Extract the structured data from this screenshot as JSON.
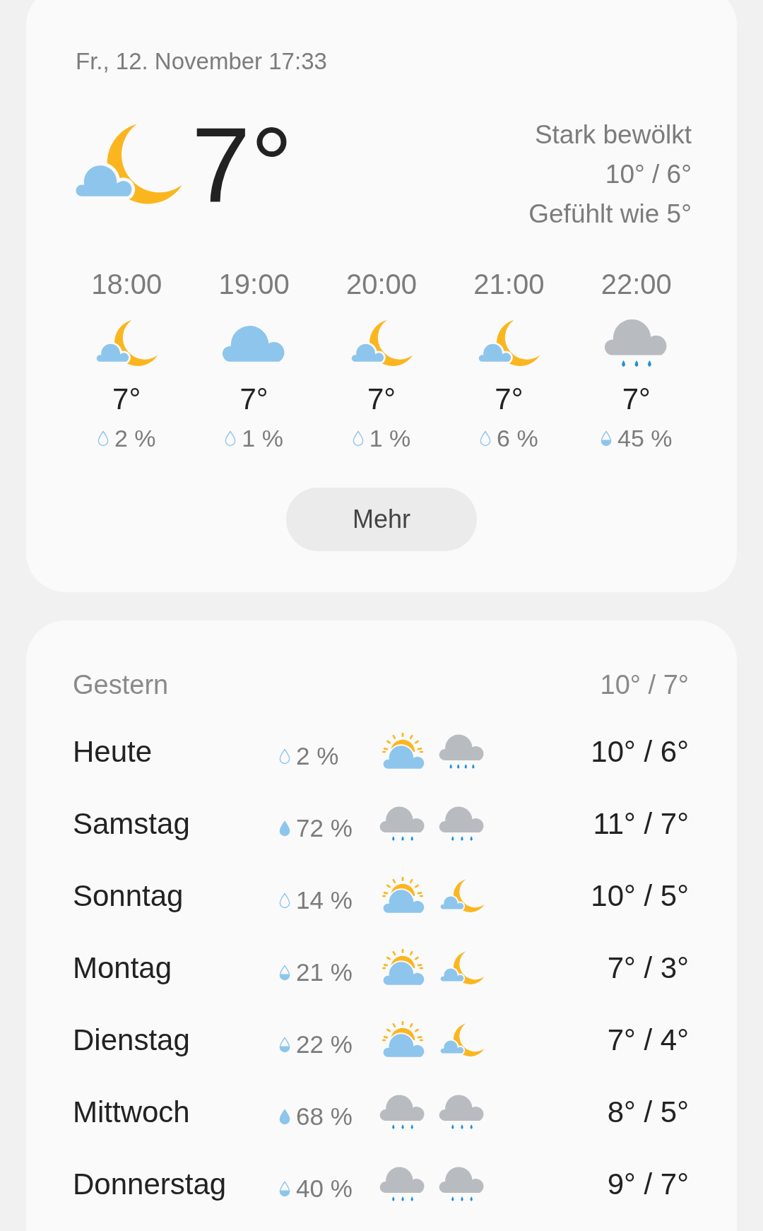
{
  "current": {
    "datetime": "Fr., 12. November 17:33",
    "icon": {
      "kind": "moon-cloud"
    },
    "temperature": "7°",
    "condition": "Stark bewölkt",
    "high_low": "10° / 6°",
    "feels_like": "Gefühlt wie 5°"
  },
  "hourly": [
    {
      "time": "18:00",
      "icon": {
        "kind": "moon-cloud"
      },
      "temperature": "7°",
      "drop": {
        "kind": "empty"
      },
      "precipitation": "2 %"
    },
    {
      "time": "19:00",
      "icon": {
        "kind": "cloud"
      },
      "temperature": "7°",
      "drop": {
        "kind": "empty"
      },
      "precipitation": "1 %"
    },
    {
      "time": "20:00",
      "icon": {
        "kind": "moon-cloud"
      },
      "temperature": "7°",
      "drop": {
        "kind": "empty"
      },
      "precipitation": "1 %"
    },
    {
      "time": "21:00",
      "icon": {
        "kind": "moon-cloud"
      },
      "temperature": "7°",
      "drop": {
        "kind": "empty"
      },
      "precipitation": "6 %"
    },
    {
      "time": "22:00",
      "icon": {
        "kind": "rain"
      },
      "temperature": "7°",
      "drop": {
        "kind": "half"
      },
      "precipitation": "45 %"
    }
  ],
  "more_button": "Mehr",
  "yesterday": {
    "label": "Gestern",
    "high_low": "10° / 7°"
  },
  "daily": [
    {
      "day": "Heute",
      "drop": {
        "kind": "empty"
      },
      "precipitation": "2 %",
      "day_icon": {
        "kind": "sun-cloud"
      },
      "night_icon": {
        "kind": "heavy-rain"
      },
      "high_low": "10° / 6°"
    },
    {
      "day": "Samstag",
      "drop": {
        "kind": "full"
      },
      "precipitation": "72 %",
      "day_icon": {
        "kind": "rain"
      },
      "night_icon": {
        "kind": "rain"
      },
      "high_low": "11° / 7°"
    },
    {
      "day": "Sonntag",
      "drop": {
        "kind": "empty"
      },
      "precipitation": "14 %",
      "day_icon": {
        "kind": "sun-cloud"
      },
      "night_icon": {
        "kind": "moon-cloud"
      },
      "high_low": "10° / 5°"
    },
    {
      "day": "Montag",
      "drop": {
        "kind": "half"
      },
      "precipitation": "21 %",
      "day_icon": {
        "kind": "sun-cloud"
      },
      "night_icon": {
        "kind": "moon-cloud"
      },
      "high_low": "7° / 3°"
    },
    {
      "day": "Dienstag",
      "drop": {
        "kind": "half"
      },
      "precipitation": "22 %",
      "day_icon": {
        "kind": "sun-cloud"
      },
      "night_icon": {
        "kind": "moon-cloud"
      },
      "high_low": "7° / 4°"
    },
    {
      "day": "Mittwoch",
      "drop": {
        "kind": "full"
      },
      "precipitation": "68 %",
      "day_icon": {
        "kind": "rain"
      },
      "night_icon": {
        "kind": "rain"
      },
      "high_low": "8° / 5°"
    },
    {
      "day": "Donnerstag",
      "drop": {
        "kind": "half"
      },
      "precipitation": "40 %",
      "day_icon": {
        "kind": "rain"
      },
      "night_icon": {
        "kind": "rain"
      },
      "high_low": "9° / 7°"
    }
  ]
}
